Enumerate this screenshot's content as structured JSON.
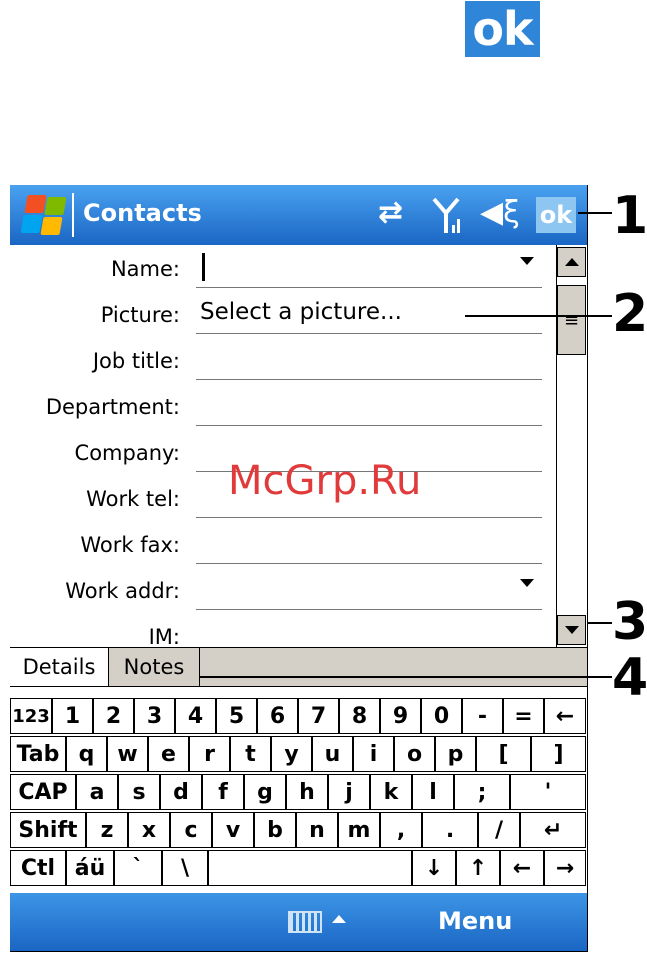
{
  "top_ok_label": "ok",
  "titlebar": {
    "title": "Contacts",
    "ok_label": "ok"
  },
  "form": {
    "fields": [
      {
        "label": "Name:",
        "value": ""
      },
      {
        "label": "Picture:",
        "value": "Select a picture..."
      },
      {
        "label": "Job title:",
        "value": ""
      },
      {
        "label": "Department:",
        "value": ""
      },
      {
        "label": "Company:",
        "value": ""
      },
      {
        "label": "Work tel:",
        "value": ""
      },
      {
        "label": "Work fax:",
        "value": ""
      },
      {
        "label": "Work addr:",
        "value": ""
      },
      {
        "label": "IM:",
        "value": ""
      }
    ]
  },
  "tabs": [
    {
      "label": "Details"
    },
    {
      "label": "Notes"
    }
  ],
  "keyboard": {
    "rows": [
      [
        "123",
        "1",
        "2",
        "3",
        "4",
        "5",
        "6",
        "7",
        "8",
        "9",
        "0",
        "-",
        "=",
        "←"
      ],
      [
        "Tab",
        "q",
        "w",
        "e",
        "r",
        "t",
        "y",
        "u",
        "i",
        "o",
        "p",
        "[",
        "]"
      ],
      [
        "CAP",
        "a",
        "s",
        "d",
        "f",
        "g",
        "h",
        "j",
        "k",
        "l",
        ";",
        "'"
      ],
      [
        "Shift",
        "z",
        "x",
        "c",
        "v",
        "b",
        "n",
        "m",
        ",",
        ".",
        "/",
        "↵"
      ],
      [
        "Ctl",
        "áü",
        "`",
        "\\",
        "",
        "↓",
        "↑",
        "←",
        "→"
      ]
    ]
  },
  "menubar": {
    "menu_label": "Menu"
  },
  "callouts": [
    "1",
    "2",
    "3",
    "4"
  ],
  "watermark": "McGrp.Ru"
}
